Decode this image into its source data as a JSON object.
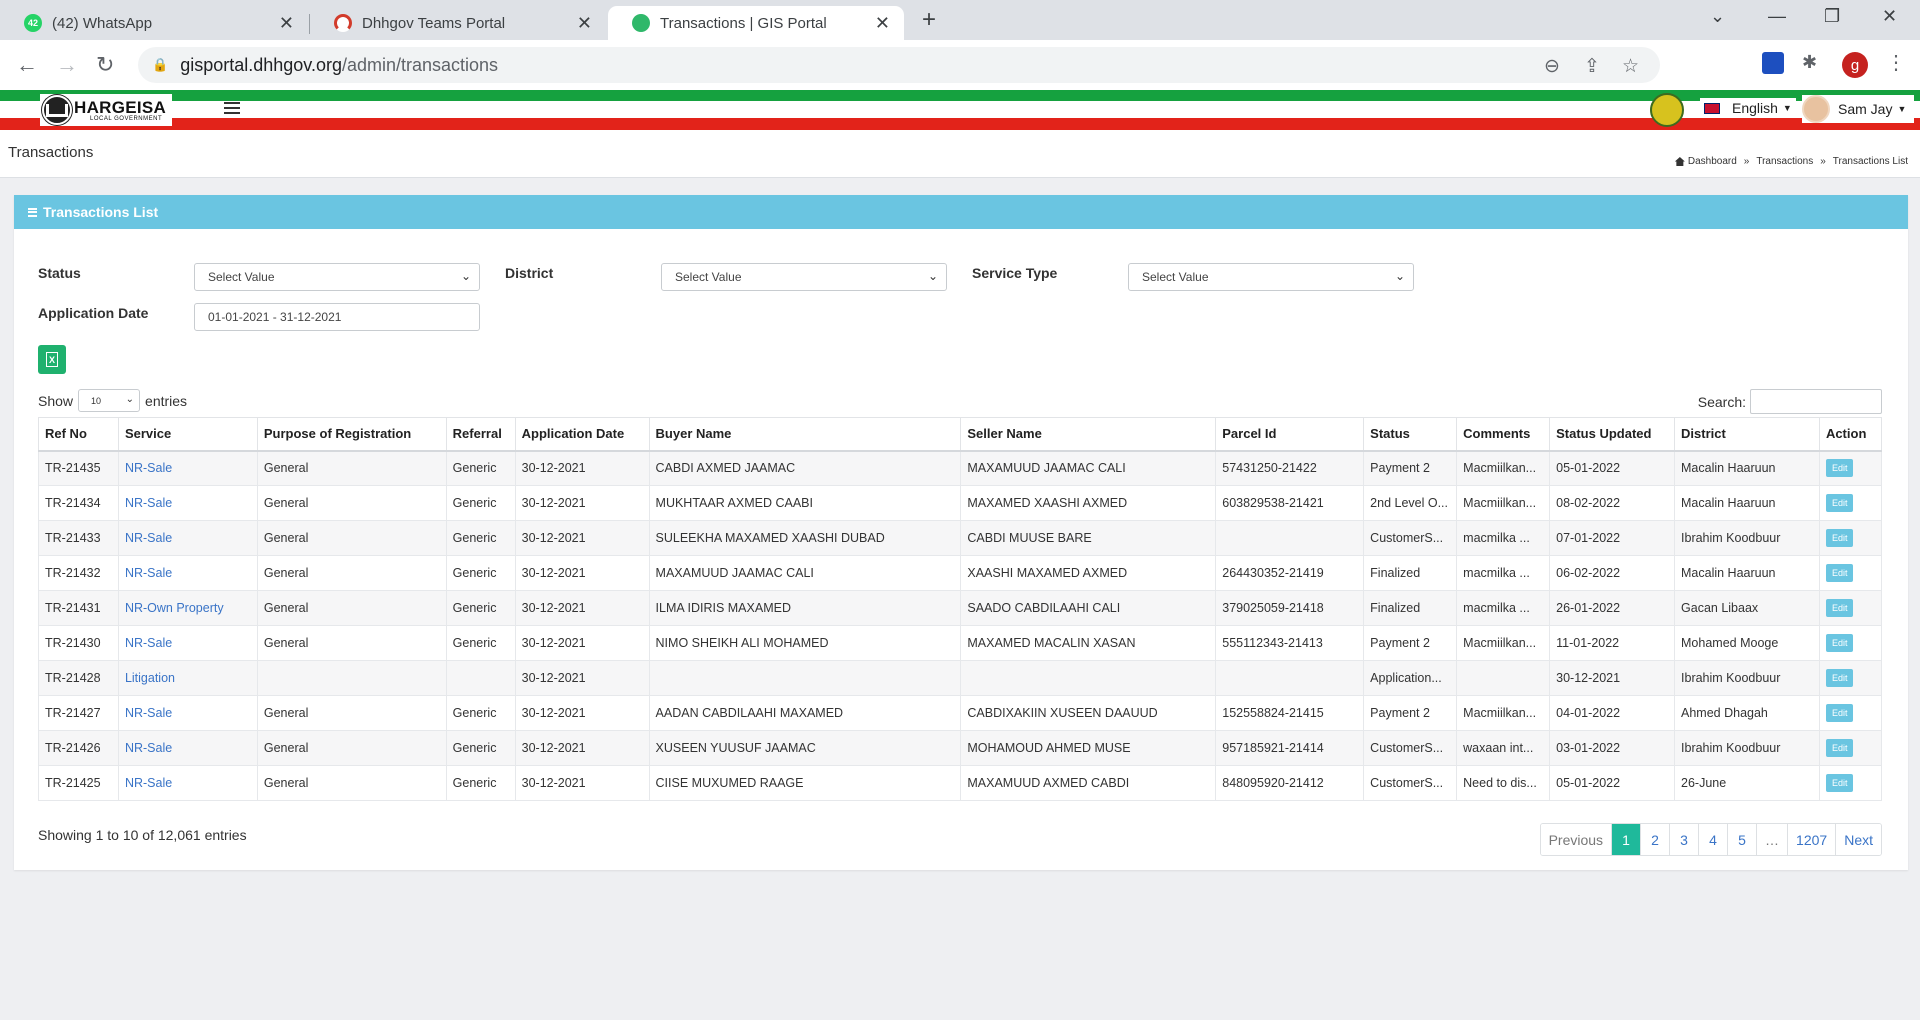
{
  "browser": {
    "tabs": [
      {
        "title": "(42) WhatsApp",
        "badge": "42"
      },
      {
        "title": "Dhhgov Teams Portal"
      },
      {
        "title": "Transactions | GIS Portal"
      }
    ],
    "close_glyph": "✕",
    "new_tab": "+",
    "url_host": "gisportal.dhhgov.org",
    "url_path": "/admin/transactions",
    "profile_initial": "g"
  },
  "header": {
    "logo_main": "HARGEISA",
    "logo_sub": "LOCAL GOVERNMENT",
    "language": "English",
    "user": "Sam Jay"
  },
  "page": {
    "title": "Transactions",
    "breadcrumbs": [
      "Dashboard",
      "Transactions",
      "Transactions List"
    ]
  },
  "card": {
    "title": "Transactions List",
    "filters": {
      "status_label": "Status",
      "status_value": "Select Value",
      "district_label": "District",
      "district_value": "Select Value",
      "service_label": "Service Type",
      "service_value": "Select Value",
      "date_label": "Application Date",
      "date_value": "01-01-2021 - 31-12-2021"
    },
    "show_label": "Show",
    "page_length": "10",
    "entries_label": "entries",
    "search_label": "Search:"
  },
  "table": {
    "columns": [
      "Ref No",
      "Service",
      "Purpose of Registration",
      "Referral",
      "Application Date",
      "Buyer Name",
      "Seller Name",
      "Parcel Id",
      "Status",
      "Comments",
      "Status Updated",
      "District",
      "Action"
    ],
    "rows": [
      [
        "TR-21435",
        "NR-Sale",
        "General",
        "Generic",
        "30-12-2021",
        "CABDI AXMED JAAMAC",
        "MAXAMUUD JAAMAC CALI",
        "57431250-21422",
        "Payment 2",
        "Macmiilkan...",
        "05-01-2022",
        "Macalin Haaruun",
        "Edit"
      ],
      [
        "TR-21434",
        "NR-Sale",
        "General",
        "Generic",
        "30-12-2021",
        "MUKHTAAR AXMED CAABI",
        "MAXAMED XAASHI AXMED",
        "603829538-21421",
        "2nd Level O...",
        "Macmiilkan...",
        "08-02-2022",
        "Macalin Haaruun",
        "Edit"
      ],
      [
        "TR-21433",
        "NR-Sale",
        "General",
        "Generic",
        "30-12-2021",
        "SULEEKHA MAXAMED XAASHI DUBAD",
        "CABDI MUUSE BARE",
        "",
        "CustomerS...",
        "macmilka ...",
        "07-01-2022",
        "Ibrahim Koodbuur",
        "Edit"
      ],
      [
        "TR-21432",
        "NR-Sale",
        "General",
        "Generic",
        "30-12-2021",
        "MAXAMUUD JAAMAC CALI",
        "XAASHI MAXAMED AXMED",
        "264430352-21419",
        "Finalized",
        "macmilka ...",
        "06-02-2022",
        "Macalin Haaruun",
        "Edit"
      ],
      [
        "TR-21431",
        "NR-Own Property",
        "General",
        "Generic",
        "30-12-2021",
        "ILMA IDIRIS MAXAMED",
        "SAADO CABDILAAHI CALI",
        "379025059-21418",
        "Finalized",
        "macmilka ...",
        "26-01-2022",
        "Gacan Libaax",
        "Edit"
      ],
      [
        "TR-21430",
        "NR-Sale",
        "General",
        "Generic",
        "30-12-2021",
        "NIMO SHEIKH ALI MOHAMED",
        "MAXAMED MACALIN XASAN",
        "555112343-21413",
        "Payment 2",
        "Macmiilkan...",
        "11-01-2022",
        "Mohamed Mooge",
        "Edit"
      ],
      [
        "TR-21428",
        "Litigation",
        "",
        "",
        "30-12-2021",
        "",
        "",
        "",
        "Application...",
        "",
        "30-12-2021",
        "Ibrahim Koodbuur",
        "Edit"
      ],
      [
        "TR-21427",
        "NR-Sale",
        "General",
        "Generic",
        "30-12-2021",
        "AADAN CABDILAAHI MAXAMED",
        "CABDIXAKIIN XUSEEN DAAUUD",
        "152558824-21415",
        "Payment 2",
        "Macmiilkan...",
        "04-01-2022",
        "Ahmed Dhagah",
        "Edit"
      ],
      [
        "TR-21426",
        "NR-Sale",
        "General",
        "Generic",
        "30-12-2021",
        "XUSEEN YUUSUF JAAMAC",
        "MOHAMOUD AHMED MUSE",
        "957185921-21414",
        "CustomerS...",
        "waxaan int...",
        "03-01-2022",
        "Ibrahim Koodbuur",
        "Edit"
      ],
      [
        "TR-21425",
        "NR-Sale",
        "General",
        "Generic",
        "30-12-2021",
        "CIISE MUXUMED RAAGE",
        "MAXAMUUD AXMED CABDI",
        "848095920-21412",
        "CustomerS...",
        "Need to dis...",
        "05-01-2022",
        "26-June",
        "Edit"
      ]
    ]
  },
  "footer": {
    "info": "Showing 1 to 10 of 12,061 entries",
    "pages": [
      "Previous",
      "1",
      "2",
      "3",
      "4",
      "5",
      "…",
      "1207",
      "Next"
    ],
    "active_page": "1"
  },
  "colors": {
    "accent": "#6ac5e1",
    "pager_active": "#1fb99b",
    "excel": "#1fb16e",
    "stripe_green": "#15a13f",
    "stripe_red": "#e2231a"
  }
}
